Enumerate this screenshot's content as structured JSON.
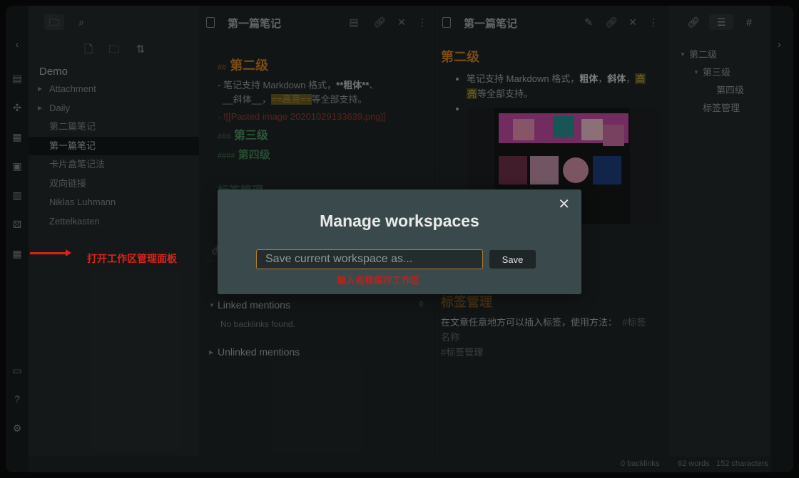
{
  "ribbon": {
    "icons": [
      "chevron-left-icon",
      "open-quick-switcher-icon",
      "graph-view-icon",
      "plugins-icon",
      "daily-note-icon",
      "templates-icon",
      "random-note-icon",
      "workspaces-icon",
      "vault-icon",
      "help-icon",
      "settings-icon"
    ]
  },
  "file_explorer": {
    "vault_name": "Demo",
    "items": [
      {
        "label": "Attachment",
        "folder": true
      },
      {
        "label": "Daily",
        "folder": true
      },
      {
        "label": "第二篇笔记",
        "folder": false
      },
      {
        "label": "第一篇笔记",
        "folder": false,
        "selected": true
      },
      {
        "label": "卡片盒笔记法",
        "folder": false
      },
      {
        "label": "双向链接",
        "folder": false
      },
      {
        "label": "Niklas Luhmann",
        "folder": false
      },
      {
        "label": "Zettelkasten",
        "folder": false
      }
    ]
  },
  "editor": {
    "title": "第一篇笔记",
    "h2_hash": "##",
    "h2_text": "第二级",
    "line1_a": "- 笔记支持 Markdown 格式，",
    "line1_b": "**粗体**",
    "line1_c": "、",
    "line2_a": "__斜体__，",
    "line2_hl": "==高亮==",
    "line2_b": "等全部支持。",
    "line3": "- ![[Pasted image 20201029133639.png]]",
    "h3_hash": "###",
    "h3_text": "第三级",
    "h4_hash": "####",
    "h4_text": "第四级",
    "faded_heading": "标签管理",
    "linked_mentions": "Linked mentions",
    "linked_count": "0",
    "no_backlinks": "No backlinks found.",
    "unlinked_mentions": "Unlinked mentions"
  },
  "preview": {
    "title": "第一篇笔记",
    "h2_text": "第二级",
    "bullet1_a": "笔记支持 Markdown 格式，",
    "bullet1_bold": "粗体",
    "bullet1_sep": "，",
    "bullet1_italic": "斜体",
    "bullet1_sep2": "，",
    "bullet1_hl1": "高",
    "bullet1_hl2": "亮",
    "bullet1_end": "等全部支持。",
    "faded_heading": "标签管理",
    "tag_text": "在文章任意地方可以插入标签，使用方法：",
    "tag_inline1": "#标签",
    "tag_inline2": "名称",
    "tag_example": "#标签管理"
  },
  "outline": {
    "items": [
      {
        "label": "第二级",
        "level": 2
      },
      {
        "label": "第三级",
        "level": 3
      },
      {
        "label": "第四级",
        "level": 4
      },
      {
        "label": "标签管理",
        "level": 2
      }
    ]
  },
  "status": {
    "backlinks": "0 backlinks",
    "words": "62 words",
    "characters": "152 characters"
  },
  "modal": {
    "title": "Manage workspaces",
    "input_placeholder": "Save current workspace as...",
    "save_label": "Save",
    "close": "✕",
    "hint": "输入名称保存工作区"
  },
  "annotation": {
    "text": "打开工作区管理面板",
    "color": "#d9231a"
  },
  "colors": {
    "accent": "#c27a23",
    "modal_bg": "#3a4a4c",
    "annotation_red": "#d9231a"
  }
}
